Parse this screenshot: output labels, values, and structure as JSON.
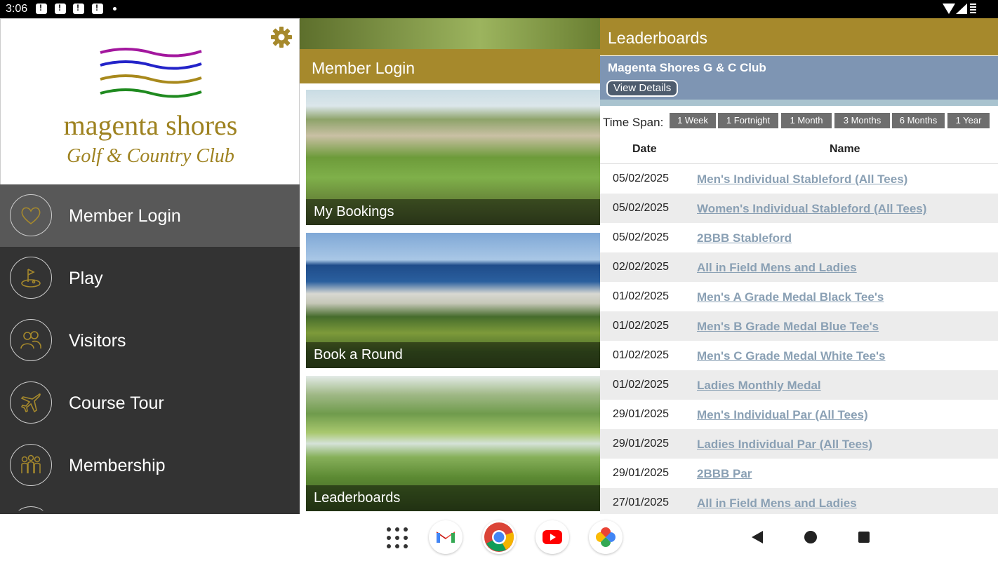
{
  "status_bar": {
    "time": "3:06"
  },
  "left_panel": {
    "logo": {
      "title": "magenta shores",
      "subtitle": "Golf & Country Club"
    },
    "menu": [
      {
        "label": "Member Login",
        "icon": "heart-icon"
      },
      {
        "label": "Play",
        "icon": "golf-flag-icon"
      },
      {
        "label": "Visitors",
        "icon": "people-icon"
      },
      {
        "label": "Course Tour",
        "icon": "airplane-icon"
      },
      {
        "label": "Membership",
        "icon": "group-icon"
      }
    ]
  },
  "middle_panel": {
    "header": "Member Login",
    "tiles": [
      {
        "label": "My Bookings"
      },
      {
        "label": "Book a Round"
      },
      {
        "label": "Leaderboards"
      }
    ]
  },
  "leaderboards": {
    "header": "Leaderboards",
    "club_name": "Magenta Shores G & C Club",
    "view_details": "View Details",
    "time_span_label": "Time Span:",
    "time_span_options": [
      "1 Week",
      "1 Fortnight",
      "1 Month",
      "3 Months",
      "6 Months",
      "1 Year"
    ],
    "columns": [
      "Date",
      "Name"
    ],
    "rows": [
      {
        "date": "05/02/2025",
        "name": "Men's Individual Stableford (All Tees)"
      },
      {
        "date": "05/02/2025",
        "name": "Women's Individual Stableford (All Tees)"
      },
      {
        "date": "05/02/2025",
        "name": "2BBB Stableford"
      },
      {
        "date": "02/02/2025",
        "name": "All in Field Mens and Ladies"
      },
      {
        "date": "01/02/2025",
        "name": "Men's A Grade Medal Black Tee's"
      },
      {
        "date": "01/02/2025",
        "name": "Men's B Grade Medal Blue Tee's"
      },
      {
        "date": "01/02/2025",
        "name": "Men's C Grade Medal White Tee's"
      },
      {
        "date": "01/02/2025",
        "name": "Ladies Monthly Medal"
      },
      {
        "date": "29/01/2025",
        "name": "Men's Individual Par (All Tees)"
      },
      {
        "date": "29/01/2025",
        "name": "Ladies Individual Par (All Tees)"
      },
      {
        "date": "29/01/2025",
        "name": "2BBB Par"
      },
      {
        "date": "27/01/2025",
        "name": "All in Field Mens and Ladies"
      }
    ]
  },
  "nav_bar": {
    "apps": [
      "app-drawer-icon",
      "gmail-icon",
      "chrome-icon",
      "youtube-icon",
      "photos-icon"
    ],
    "buttons": [
      "back-icon",
      "home-icon",
      "recents-icon"
    ]
  },
  "colors": {
    "gold": "#a6892c",
    "club_bar": "#7e95b3",
    "menu_bg": "#333333",
    "link": "#8aa0b4"
  }
}
